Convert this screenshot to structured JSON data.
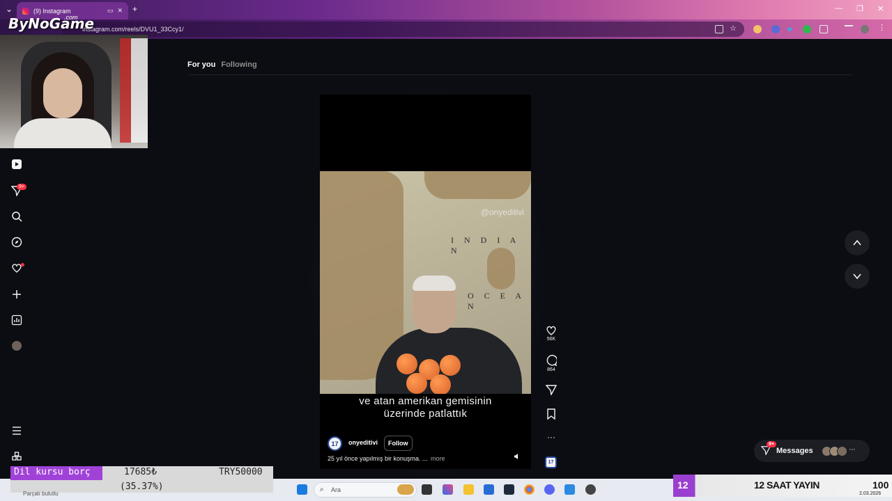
{
  "browser": {
    "tab_title": "(9) Instagram",
    "url": "instagram.com/reels/DVU1_33Ccy1/",
    "new_tab": "+",
    "tab_close": "✕"
  },
  "overlay": {
    "brand": "ByNoGame",
    "brand_sub": ".com"
  },
  "nav": {
    "notifications_badge": "9+"
  },
  "feed_tabs": {
    "for_you": "For you",
    "following": "Following"
  },
  "reel": {
    "watermark": "@onyeditivi",
    "map_labels": [
      "I N D I A N",
      "O C E A N"
    ],
    "subtitle_line1": "ve atan amerikan gemisinin",
    "subtitle_line2": "üzerinde patlattık",
    "author_avatar": "17",
    "author": "onyeditivi",
    "follow_label": "Follow",
    "caption": "25 yıl önce yapılmış bir konuşma. ...",
    "more_label": "more"
  },
  "actions": {
    "likes": "56K",
    "comments": "864"
  },
  "messages": {
    "label": "Messages",
    "badge": "9+"
  },
  "goal": {
    "label": "Dil kursu borç",
    "amount": "17685₺",
    "target": "TRY50000",
    "percent_text": "(35.37%)",
    "progress": 0.3537,
    "now_playing": "Parçalı bulutlu"
  },
  "taskbar": {
    "search_placeholder": "Ara"
  },
  "stream": {
    "day": "12",
    "text": "12 SAAT YAYIN",
    "count": "100",
    "date": "2.03.2026"
  },
  "colors": {
    "instagram_bg": "#0b0d12",
    "badge_red": "#ff3040",
    "goal_purple": "#a042d8"
  }
}
